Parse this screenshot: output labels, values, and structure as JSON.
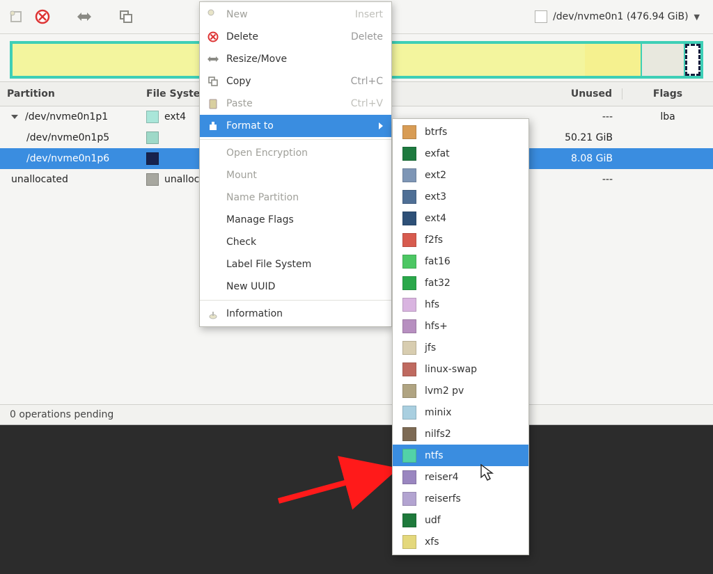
{
  "toolbar": {
    "device_label": "/dev/nvme0n1 (476.94 GiB)"
  },
  "columns": {
    "partition": "Partition",
    "filesystem": "File System",
    "unused": "Unused",
    "flags": "Flags"
  },
  "rows": [
    {
      "name": "/dev/nvme0n1p1",
      "indent": 0,
      "expander": true,
      "fs_label": "ext4",
      "swatch": "#a9e6d9",
      "unused": "---",
      "flags": "lba",
      "selected": false
    },
    {
      "name": "/dev/nvme0n1p5",
      "indent": 1,
      "expander": false,
      "fs_label": "",
      "swatch": "#9ed9c8",
      "unused": "50.21 GiB",
      "flags": "",
      "selected": false
    },
    {
      "name": "/dev/nvme0n1p6",
      "indent": 1,
      "expander": false,
      "fs_label": "",
      "swatch": "#17234d",
      "unused": "8.08 GiB",
      "flags": "",
      "selected": true
    },
    {
      "name": "unallocated",
      "indent": 0,
      "expander": false,
      "fs_label": "unallocated",
      "swatch": "#a7a79f",
      "unused": "---",
      "flags": "",
      "selected": false
    }
  ],
  "status": "0 operations pending",
  "menu": {
    "items": [
      {
        "icon": "new",
        "label": "New",
        "shortcut": "Insert",
        "disabled": true
      },
      {
        "icon": "delete",
        "label": "Delete",
        "shortcut": "Delete",
        "disabled": false
      },
      {
        "icon": "resize",
        "label": "Resize/Move",
        "shortcut": "",
        "disabled": false
      },
      {
        "icon": "copy",
        "label": "Copy",
        "shortcut": "Ctrl+C",
        "disabled": false
      },
      {
        "icon": "paste",
        "label": "Paste",
        "shortcut": "Ctrl+V",
        "disabled": true
      },
      {
        "icon": "format",
        "label": "Format to",
        "shortcut": "",
        "disabled": false,
        "submenu": true,
        "highlight": true
      },
      {
        "icon": "",
        "label": "Open Encryption",
        "shortcut": "",
        "disabled": true
      },
      {
        "icon": "",
        "label": "Mount",
        "shortcut": "",
        "disabled": true
      },
      {
        "icon": "",
        "label": "Name Partition",
        "shortcut": "",
        "disabled": true
      },
      {
        "icon": "",
        "label": "Manage Flags",
        "shortcut": "",
        "disabled": false
      },
      {
        "icon": "",
        "label": "Check",
        "shortcut": "",
        "disabled": false
      },
      {
        "icon": "",
        "label": "Label File System",
        "shortcut": "",
        "disabled": false
      },
      {
        "icon": "",
        "label": "New UUID",
        "shortcut": "",
        "disabled": false
      },
      {
        "icon": "info",
        "label": "Information",
        "shortcut": "",
        "disabled": false
      }
    ]
  },
  "submenu": {
    "items": [
      {
        "label": "btrfs",
        "swatch": "#d89c55",
        "highlight": false
      },
      {
        "label": "exfat",
        "swatch": "#1e7a3f",
        "highlight": false
      },
      {
        "label": "ext2",
        "swatch": "#7e96b6",
        "highlight": false
      },
      {
        "label": "ext3",
        "swatch": "#4f6f95",
        "highlight": false
      },
      {
        "label": "ext4",
        "swatch": "#2e5077",
        "highlight": false
      },
      {
        "label": "f2fs",
        "swatch": "#d75b4e",
        "highlight": false
      },
      {
        "label": "fat16",
        "swatch": "#4cc763",
        "highlight": false
      },
      {
        "label": "fat32",
        "swatch": "#2aa84a",
        "highlight": false
      },
      {
        "label": "hfs",
        "swatch": "#d9b4e0",
        "highlight": false
      },
      {
        "label": "hfs+",
        "swatch": "#b78fc0",
        "highlight": false
      },
      {
        "label": "jfs",
        "swatch": "#d8cdb0",
        "highlight": false
      },
      {
        "label": "linux-swap",
        "swatch": "#bf6a60",
        "highlight": false
      },
      {
        "label": "lvm2 pv",
        "swatch": "#b0a482",
        "highlight": false
      },
      {
        "label": "minix",
        "swatch": "#a9cfe0",
        "highlight": false
      },
      {
        "label": "nilfs2",
        "swatch": "#7d6a54",
        "highlight": false
      },
      {
        "label": "ntfs",
        "swatch": "#52d2a8",
        "highlight": true
      },
      {
        "label": "reiser4",
        "swatch": "#9a86c0",
        "highlight": false
      },
      {
        "label": "reiserfs",
        "swatch": "#b3a4d1",
        "highlight": false
      },
      {
        "label": "udf",
        "swatch": "#1f7a3c",
        "highlight": false
      },
      {
        "label": "xfs",
        "swatch": "#e4d87c",
        "highlight": false
      }
    ]
  }
}
